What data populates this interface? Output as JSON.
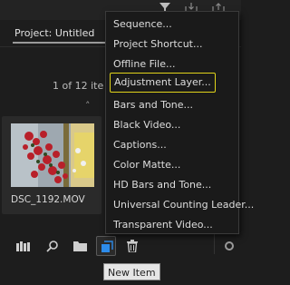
{
  "project": {
    "tab_label": "Project: Untitled",
    "item_count": "1 of 12 ite",
    "sort_indicator": "˄"
  },
  "thumbnail": {
    "filename": "DSC_1192.MOV"
  },
  "menu": {
    "items": [
      {
        "label": "Sequence..."
      },
      {
        "label": "Project Shortcut..."
      },
      {
        "label": "Offline File..."
      },
      {
        "label": "Adjustment Layer...",
        "highlighted": true
      },
      {
        "label": "Bars and Tone..."
      },
      {
        "label": "Black Video..."
      },
      {
        "label": "Captions..."
      },
      {
        "label": "Color Matte..."
      },
      {
        "label": "HD Bars and Tone..."
      },
      {
        "label": "Universal Counting Leader..."
      },
      {
        "label": "Transparent Video..."
      }
    ]
  },
  "toolbar": {
    "icons": [
      "bin-icon",
      "search-icon",
      "folder-icon",
      "new-item-icon",
      "trash-icon"
    ]
  },
  "tooltip": {
    "text": "New Item"
  },
  "colors": {
    "highlight_border": "#e0d31a",
    "accent_blue": "#2d8ceb",
    "background": "#1d1d1d"
  }
}
